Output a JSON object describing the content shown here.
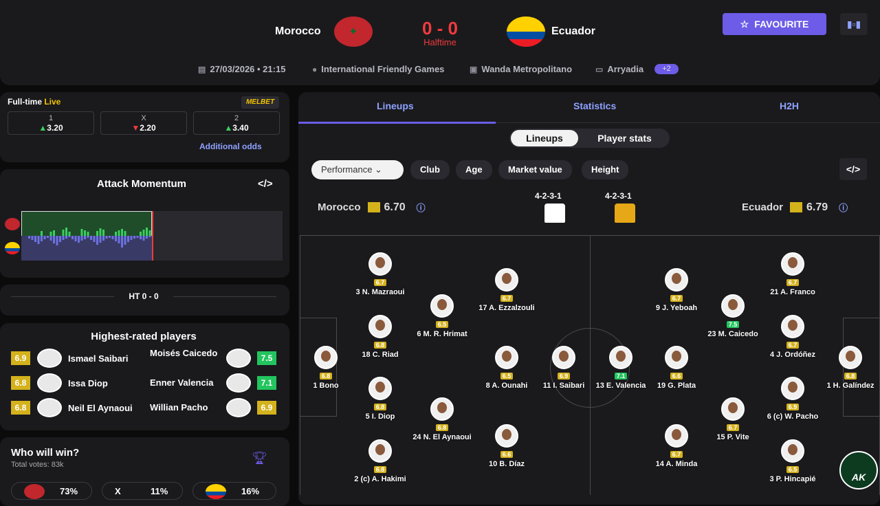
{
  "match": {
    "home": "Morocco",
    "away": "Ecuador",
    "score": "0 - 0",
    "status": "Halftime",
    "favourite": "FAVOURITE",
    "date": "27/03/2026 • 21:15",
    "competition": "International Friendly Games",
    "venue": "Wanda Metropolitano",
    "referee": "Arryadia",
    "more": "+2"
  },
  "odds": {
    "label": "Full-time",
    "live": "Live",
    "brand": "MELBET",
    "boxes": [
      {
        "k": "1",
        "v": "3.20",
        "dir": "up"
      },
      {
        "k": "X",
        "v": "2.20",
        "dir": "down"
      },
      {
        "k": "2",
        "v": "3.40",
        "dir": "up"
      }
    ],
    "more": "Additional odds"
  },
  "momentum": {
    "title": "Attack Momentum",
    "embed": "</>",
    "ht": "HT 0 - 0"
  },
  "top_players": {
    "title": "Highest-rated players",
    "left": [
      {
        "name": "Ismael Saibari",
        "r": "6.9"
      },
      {
        "name": "Issa Diop",
        "r": "6.8"
      },
      {
        "name": "Neil El Aynaoui",
        "r": "6.8"
      }
    ],
    "right": [
      {
        "name": "Moisés Caicedo",
        "r": "7.5"
      },
      {
        "name": "Enner Valencia",
        "r": "7.1"
      },
      {
        "name": "Willian Pacho",
        "r": "6.9"
      }
    ]
  },
  "poll": {
    "title": "Who will win?",
    "votes": "Total votes: 83k",
    "home": "73%",
    "draw_k": "X",
    "draw": "11%",
    "away": "16%"
  },
  "tabs": [
    "Lineups",
    "Statistics",
    "H2H"
  ],
  "subtabs": [
    "Lineups",
    "Player stats"
  ],
  "filters": [
    "Performance",
    "Club",
    "Age",
    "Market value",
    "Height"
  ],
  "lineup": {
    "home": "Morocco",
    "home_r": "6.70",
    "away": "Ecuador",
    "away_r": "6.79",
    "home_form": "4-2-3-1",
    "away_form": "4-2-3-1"
  },
  "players": [
    {
      "n": "1 Bono",
      "r": "6.8"
    },
    {
      "n": "3 N. Mazraoui",
      "r": "6.7"
    },
    {
      "n": "18 C. Riad",
      "r": "6.8"
    },
    {
      "n": "5 I. Diop",
      "r": "6.8"
    },
    {
      "n": "2 (c) A. Hakimi",
      "r": "6.8"
    },
    {
      "n": "6 M. R. Hrimat",
      "r": "6.5"
    },
    {
      "n": "24 N. El Aynaoui",
      "r": "6.8"
    },
    {
      "n": "17 A. Ezzalzouli",
      "r": "6.7"
    },
    {
      "n": "8 A. Ounahi",
      "r": "6.5"
    },
    {
      "n": "10 B. Díaz",
      "r": "6.6"
    },
    {
      "n": "11 I. Saibari",
      "r": "6.9"
    },
    {
      "n": "13 E. Valencia",
      "r": "7.1"
    },
    {
      "n": "9 J. Yeboah",
      "r": "6.7"
    },
    {
      "n": "19 G. Plata",
      "r": "6.6"
    },
    {
      "n": "14 A. Minda",
      "r": "6.7"
    },
    {
      "n": "23 M. Caicedo",
      "r": "7.5"
    },
    {
      "n": "15 P. Vite",
      "r": "6.7"
    },
    {
      "n": "21 A. Franco",
      "r": "6.7"
    },
    {
      "n": "4 J. Ordóñez",
      "r": "6.7"
    },
    {
      "n": "6 (c) W. Pacho",
      "r": "6.9"
    },
    {
      "n": "3 P. Hincapié",
      "r": "6.5"
    },
    {
      "n": "1 H. Galíndez",
      "r": "6.8"
    }
  ],
  "watermark": "AK"
}
